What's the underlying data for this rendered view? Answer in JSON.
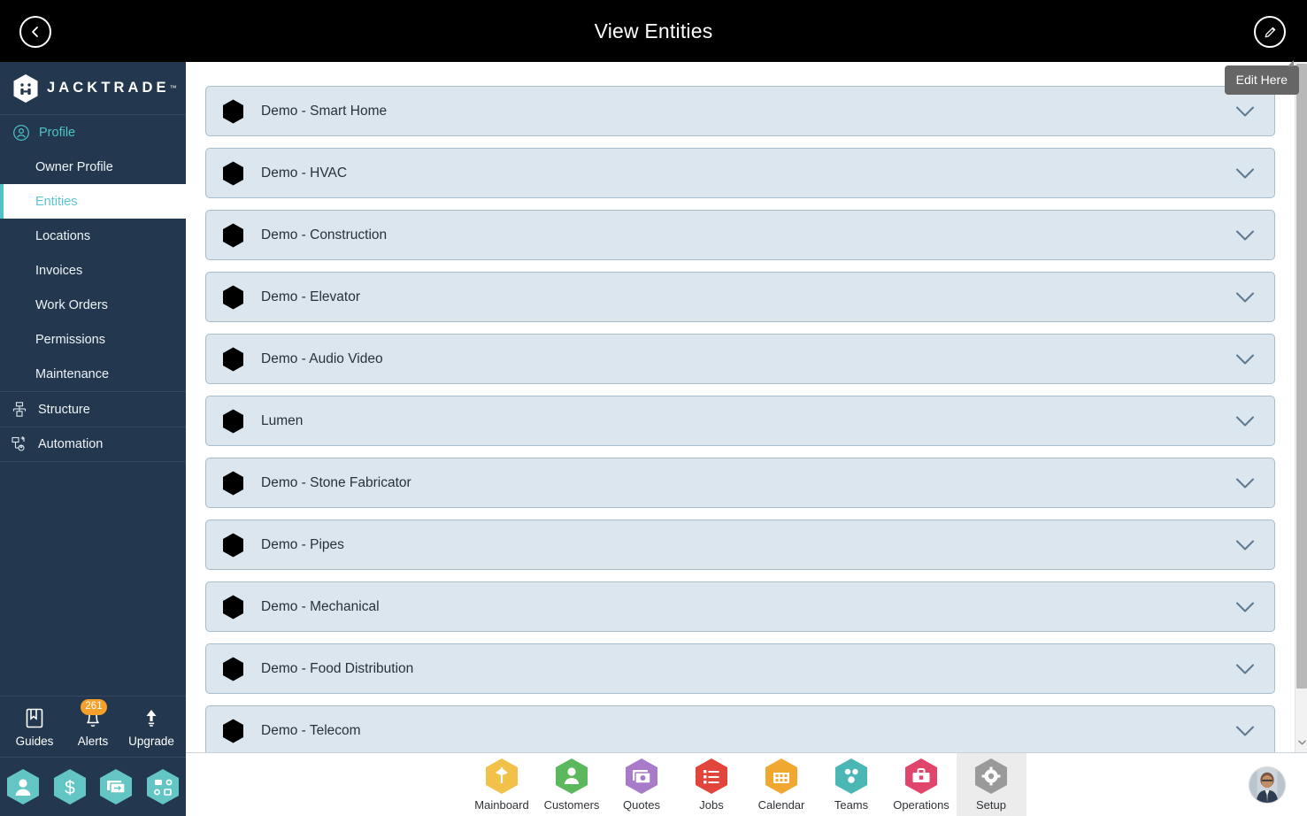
{
  "header": {
    "title": "View Entities",
    "back_icon": "chevron-left-icon",
    "edit_icon": "pencil-icon"
  },
  "tooltip": {
    "text": "Edit Here"
  },
  "sidebar": {
    "brand": {
      "name": "JACKTRADE",
      "tm": "™",
      "logo_icon": "jacktrade-hex-logo-icon"
    },
    "group": {
      "label": "Profile",
      "icon": "user-circle-icon"
    },
    "items": [
      {
        "label": "Owner Profile",
        "active": false
      },
      {
        "label": "Entities",
        "active": true
      },
      {
        "label": "Locations",
        "active": false
      },
      {
        "label": "Invoices",
        "active": false
      },
      {
        "label": "Work Orders",
        "active": false
      },
      {
        "label": "Permissions",
        "active": false
      },
      {
        "label": "Maintenance",
        "active": false
      }
    ],
    "sections": [
      {
        "label": "Structure",
        "icon": "structure-tree-icon"
      },
      {
        "label": "Automation",
        "icon": "automation-flow-icon"
      }
    ],
    "utils": [
      {
        "label": "Guides",
        "icon": "book-icon",
        "badge": ""
      },
      {
        "label": "Alerts",
        "icon": "bell-icon",
        "badge": "261"
      },
      {
        "label": "Upgrade",
        "icon": "up-arrow-icon",
        "badge": ""
      }
    ],
    "quick_actions": [
      {
        "icon": "person-hex-icon"
      },
      {
        "icon": "dollar-hex-icon"
      },
      {
        "icon": "money-transfer-hex-icon"
      },
      {
        "icon": "workflow-hex-icon"
      }
    ]
  },
  "main": {
    "row_icon": "hexagon-icon",
    "row_expand_icon": "chevron-down-icon",
    "entities": [
      {
        "name": "Demo - Smart Home"
      },
      {
        "name": "Demo - HVAC"
      },
      {
        "name": "Demo - Construction"
      },
      {
        "name": "Demo - Elevator"
      },
      {
        "name": "Demo - Audio Video"
      },
      {
        "name": "Lumen"
      },
      {
        "name": "Demo - Stone Fabricator"
      },
      {
        "name": "Demo - Pipes"
      },
      {
        "name": "Demo - Mechanical"
      },
      {
        "name": "Demo - Food Distribution"
      },
      {
        "name": "Demo - Telecom"
      }
    ]
  },
  "bottom_nav": {
    "tabs": [
      {
        "label": "Mainboard",
        "icon": "mainboard-icon",
        "color": "#f2c14a",
        "active": false
      },
      {
        "label": "Customers",
        "icon": "customers-icon",
        "color": "#5cb85c",
        "active": false
      },
      {
        "label": "Quotes",
        "icon": "quotes-icon",
        "color": "#a77bca",
        "active": false
      },
      {
        "label": "Jobs",
        "icon": "jobs-icon",
        "color": "#e2453c",
        "active": false
      },
      {
        "label": "Calendar",
        "icon": "calendar-icon",
        "color": "#f0a830",
        "active": false
      },
      {
        "label": "Teams",
        "icon": "teams-icon",
        "color": "#4bb7b5",
        "active": false
      },
      {
        "label": "Operations",
        "icon": "operations-icon",
        "color": "#e0456b",
        "active": false
      },
      {
        "label": "Setup",
        "icon": "setup-gear-icon",
        "color": "#9a9a9a",
        "active": true
      }
    ],
    "avatar": {
      "icon": "user-avatar"
    }
  },
  "colors": {
    "topbar_bg": "#000000",
    "sidebar_bg": "#23384e",
    "accent_teal": "#4ec3c6",
    "row_bg": "#dbe6ef",
    "row_border": "#a9bccb",
    "badge_orange": "#f5a02a",
    "tooltip_bg": "#666666"
  }
}
